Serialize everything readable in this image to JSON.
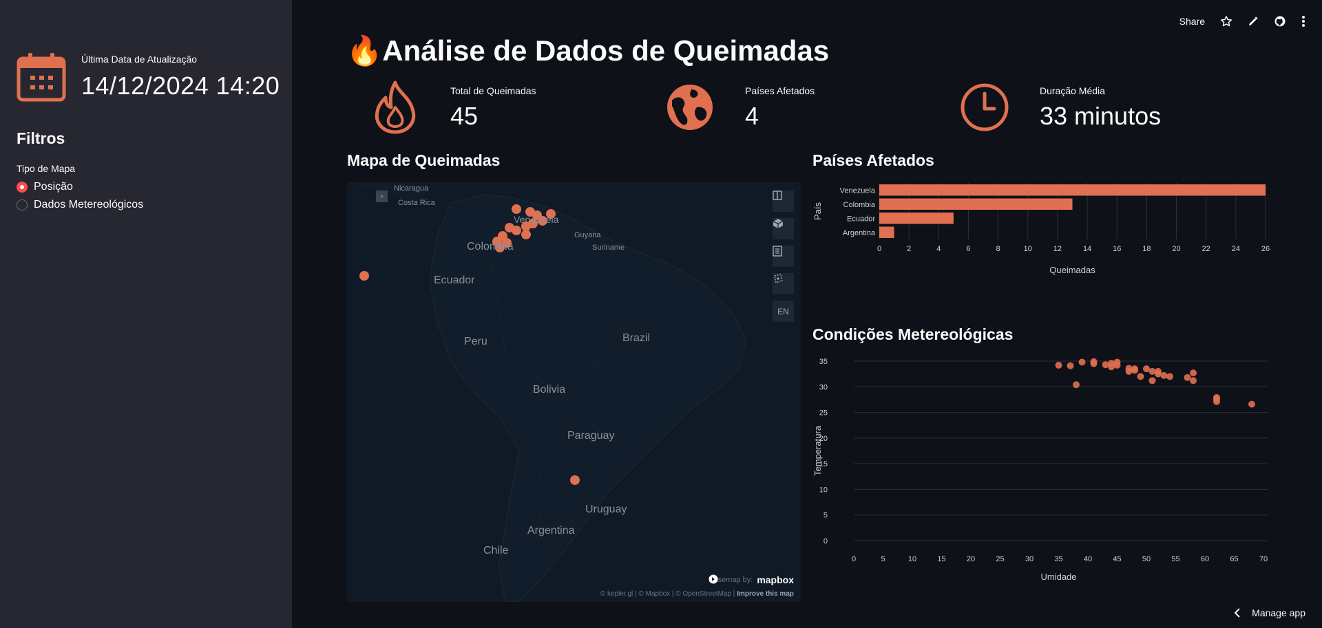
{
  "sidebar": {
    "update_label": "Última Data de Atualização",
    "update_value": "14/12/2024 14:20",
    "filters_title": "Filtros",
    "map_type_label": "Tipo de Mapa",
    "map_type_options": [
      "Posição",
      "Dados Metereológicos"
    ],
    "map_type_selected": "Posição"
  },
  "topbar": {
    "share_label": "Share"
  },
  "main": {
    "title": "🔥Análise de Dados de Queimadas",
    "metrics": [
      {
        "label": "Total de Queimadas",
        "value": "45",
        "icon": "fire-icon"
      },
      {
        "label": "Países Afetados",
        "value": "4",
        "icon": "globe-icon"
      },
      {
        "label": "Duração Média",
        "value": "33 minutos",
        "icon": "clock-icon"
      }
    ],
    "map_title": "Mapa de Queimadas",
    "countries_title": "Países Afetados",
    "weather_title": "Condições Metereológicas"
  },
  "map": {
    "labels": {
      "nicaragua": "Nicaragua",
      "costa_rica": "Costa Rica",
      "venezuela": "Venezuela",
      "guyana": "Guyana",
      "suriname": "Suriname",
      "colombia": "Colombia",
      "ecuador": "Ecuador",
      "peru": "Peru",
      "brazil": "Brazil",
      "bolivia": "Bolivia",
      "paraguay": "Paraguay",
      "uruguay": "Uruguay",
      "argentina": "Argentina",
      "chile": "Chile"
    },
    "ctrl_lang": "EN",
    "basemap_label": "Basemap by:",
    "mapbox_logo": "mapbox",
    "attribution": "© kepler.gl | © Mapbox | © OpenStreetMap |",
    "improve_link": "Improve this map"
  },
  "footer": {
    "manage_label": "Manage app"
  },
  "colors": {
    "accent": "#e07050",
    "sidebar_bg": "#262730",
    "main_bg": "#0e1117",
    "radio": "#ff4b4b"
  },
  "chart_data": [
    {
      "type": "bar",
      "orientation": "horizontal",
      "categories": [
        "Venezuela",
        "Colombia",
        "Ecuador",
        "Argentina"
      ],
      "values": [
        26,
        13,
        5,
        1
      ],
      "xlabel": "Queimadas",
      "ylabel": "País",
      "xlim": [
        0,
        26
      ],
      "xticks": [
        0,
        2,
        4,
        6,
        8,
        10,
        12,
        14,
        16,
        18,
        20,
        22,
        24,
        26
      ],
      "grid": true
    },
    {
      "type": "scatter",
      "xlabel": "Umidade",
      "ylabel": "Temperatura",
      "xlim": [
        0,
        70
      ],
      "ylim": [
        0,
        35
      ],
      "xticks": [
        0,
        5,
        10,
        15,
        20,
        25,
        30,
        35,
        40,
        45,
        50,
        55,
        60,
        65,
        70
      ],
      "yticks": [
        0,
        5,
        10,
        15,
        20,
        25,
        30,
        35
      ],
      "grid": true,
      "points": [
        [
          35,
          34.2
        ],
        [
          37,
          34.1
        ],
        [
          38,
          30.4
        ],
        [
          39,
          34.8
        ],
        [
          41,
          34.9
        ],
        [
          41,
          34.5
        ],
        [
          43,
          34.3
        ],
        [
          44,
          33.9
        ],
        [
          44,
          34.6
        ],
        [
          45,
          34.8
        ],
        [
          45,
          34.2
        ],
        [
          47,
          33.0
        ],
        [
          47,
          33.6
        ],
        [
          48,
          33.2
        ],
        [
          48,
          33.5
        ],
        [
          49,
          32.0
        ],
        [
          50,
          33.5
        ],
        [
          51,
          31.2
        ],
        [
          51,
          33.0
        ],
        [
          52,
          32.5
        ],
        [
          52,
          33.0
        ],
        [
          53,
          32.2
        ],
        [
          54,
          32.0
        ],
        [
          57,
          31.8
        ],
        [
          58,
          31.2
        ],
        [
          58,
          32.7
        ],
        [
          62,
          27.1
        ],
        [
          62,
          27.6
        ],
        [
          62,
          27.9
        ],
        [
          68,
          26.6
        ]
      ]
    }
  ]
}
